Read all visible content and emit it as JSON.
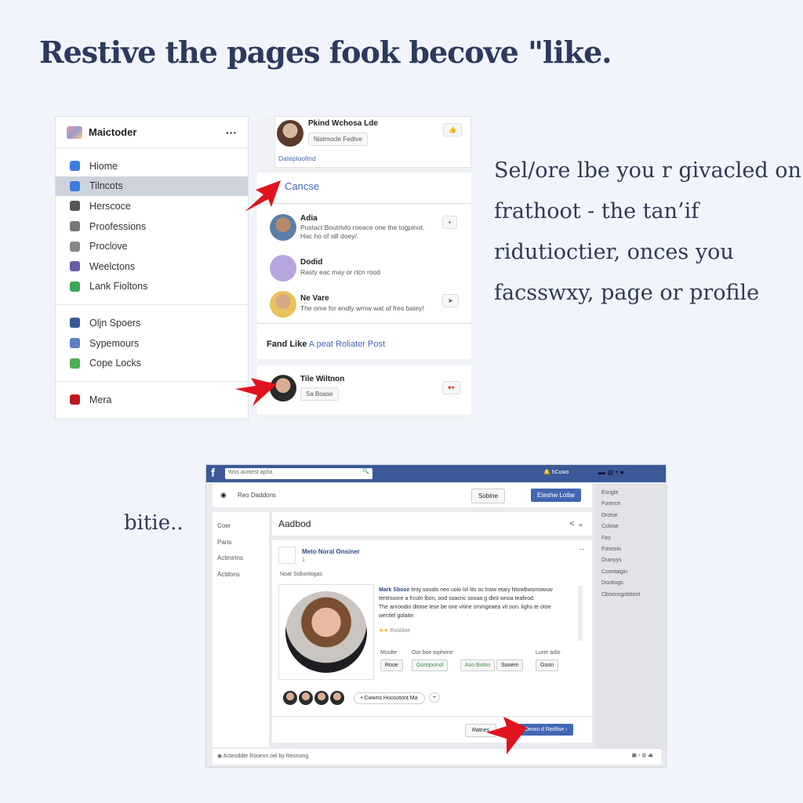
{
  "headline": "Restive the pages fook becove \"like.",
  "side_text": [
    "Sel/ore lbe you r givacled on",
    "frathoot - the tan’if",
    "ridutioctier, onces you",
    "facsswxy, page or profile"
  ],
  "bottom_caption": "bitie..",
  "sidebar": {
    "title": "Maictoder",
    "more": "···",
    "groups": [
      [
        {
          "label": "Hiome",
          "icon": "home-icon",
          "color": "#3b7ddd"
        },
        {
          "label": "Tilncots",
          "icon": "contacts-icon",
          "color": "#3b7ddd",
          "active": true
        },
        {
          "label": "Herscoce",
          "icon": "fork-icon",
          "color": "#555"
        },
        {
          "label": "Proofessions",
          "icon": "document-icon",
          "color": "#777"
        },
        {
          "label": "Proclove",
          "icon": "clock-icon",
          "color": "#888"
        },
        {
          "label": "Weelctons",
          "icon": "video-icon",
          "color": "#6b5ba8"
        },
        {
          "label": "Lank Fioltons",
          "icon": "link-icon",
          "color": "#3aa757"
        }
      ],
      [
        {
          "label": "Oljn Spoers",
          "icon": "facebook-icon",
          "color": "#3b5998"
        },
        {
          "label": "Sypemours",
          "icon": "message-icon",
          "color": "#5b7fc0"
        },
        {
          "label": "Cope Locks",
          "icon": "calendar-icon",
          "color": "#4caf50"
        }
      ],
      [
        {
          "label": "Mera",
          "icon": "media-icon",
          "color": "#c0161c"
        }
      ]
    ]
  },
  "feed": {
    "top": {
      "name": "Pkind Wchosa Lde",
      "button": "Nistmocle Fedtve",
      "link": "Dateplooltnd"
    },
    "cancel": "Cancse",
    "people": [
      {
        "name": "Adia",
        "text": "Pustact Boutrtvlo roeace one the togpinot.",
        "text2": "Hac ho of sill doey/."
      },
      {
        "name": "Dodid",
        "text": "Rasty eac may or rtcn rood"
      },
      {
        "name": "Ne Vare",
        "text": "The ome for endly wrnw wat af fres batey!"
      }
    ],
    "find_like": "Fand Like",
    "find_like_link": "A peat Roliater Post",
    "bottom": {
      "name": "Tile Wiltnon",
      "button": "Sa Boase"
    }
  },
  "fb": {
    "search_placeholder": "Wos aumest apha",
    "notif": "hCuwo",
    "page_name": "Reo Daddons",
    "save": "Sobine",
    "primary": "Eteshw Lotlar",
    "nav": [
      "Coer",
      "Paris",
      "Actmirins",
      "Actdons"
    ],
    "section_title": "Aadbod",
    "post": {
      "author": "Meto Noral Onsiner",
      "meta": "1",
      "subtitle": "Noar Sobonlogas",
      "body_author": "Mark Sbose",
      "body": "tinty sooals neo uoio lol lits oc lnow etary Ntowbwsmowuw tentrsoore a frcoln lbon, ood soacric sooaa g dleit wnoa teafirod.",
      "body2": "The anroodio dlotoe lese be one vitine smmgeaea vit oon. lighs te otoe wectlel golaite.",
      "rating": "Rosldoe",
      "labels": [
        "Moulte",
        "Oor boe tophone",
        "Lurer adio"
      ],
      "tags": [
        "Rooe",
        "Gonqoonol",
        "Aso Botnn",
        "Sooem",
        "Goon"
      ],
      "audience": "Cwwns Hoosotont Ma",
      "cancel": "Ratnes",
      "submit": "Deoro d Reitfise"
    },
    "right": [
      "Esngle",
      "Forerce",
      "Drotse",
      "Colose",
      "Fes",
      "Fonosio",
      "Dranyys",
      "Cosntaigin",
      "Dootiogs",
      "Cboonngnbtiont"
    ],
    "footer": "Acteoddte Rooevn oel by Reonong"
  },
  "colors": {
    "fb_blue": "#3b5998",
    "primary": "#4267b2",
    "arrow": "#e0141e",
    "navy": "#2b3a5e"
  }
}
